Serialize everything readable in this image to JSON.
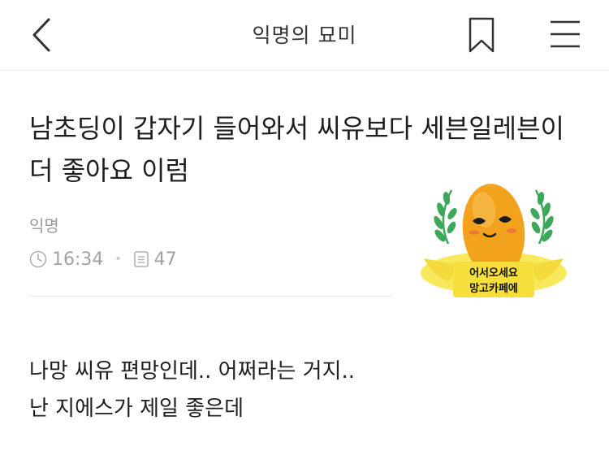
{
  "header": {
    "title": "익명의 묘미",
    "back_icon": "chevron-left-icon",
    "bookmark_icon": "bookmark-icon",
    "menu_icon": "hamburger-menu-icon"
  },
  "post": {
    "title": "남초딩이 갑자기 들어와서 씨유보다 세븐일레븐이 더 좋아요 이럼",
    "author": "익명",
    "time": "16:34",
    "views": "47",
    "body_lines": [
      "나망 씨유 편망인데.. 어쩌라는 거지..",
      "난 지에스가 제일 좋은데"
    ]
  },
  "sticker": {
    "line1": "어서오세요",
    "line2": "망고카페에"
  },
  "colors": {
    "text": "#1e1e1e",
    "meta": "#a2a2a2",
    "mango": "#f2a21c",
    "leaf": "#3da75a",
    "glow": "#f7e64a"
  }
}
